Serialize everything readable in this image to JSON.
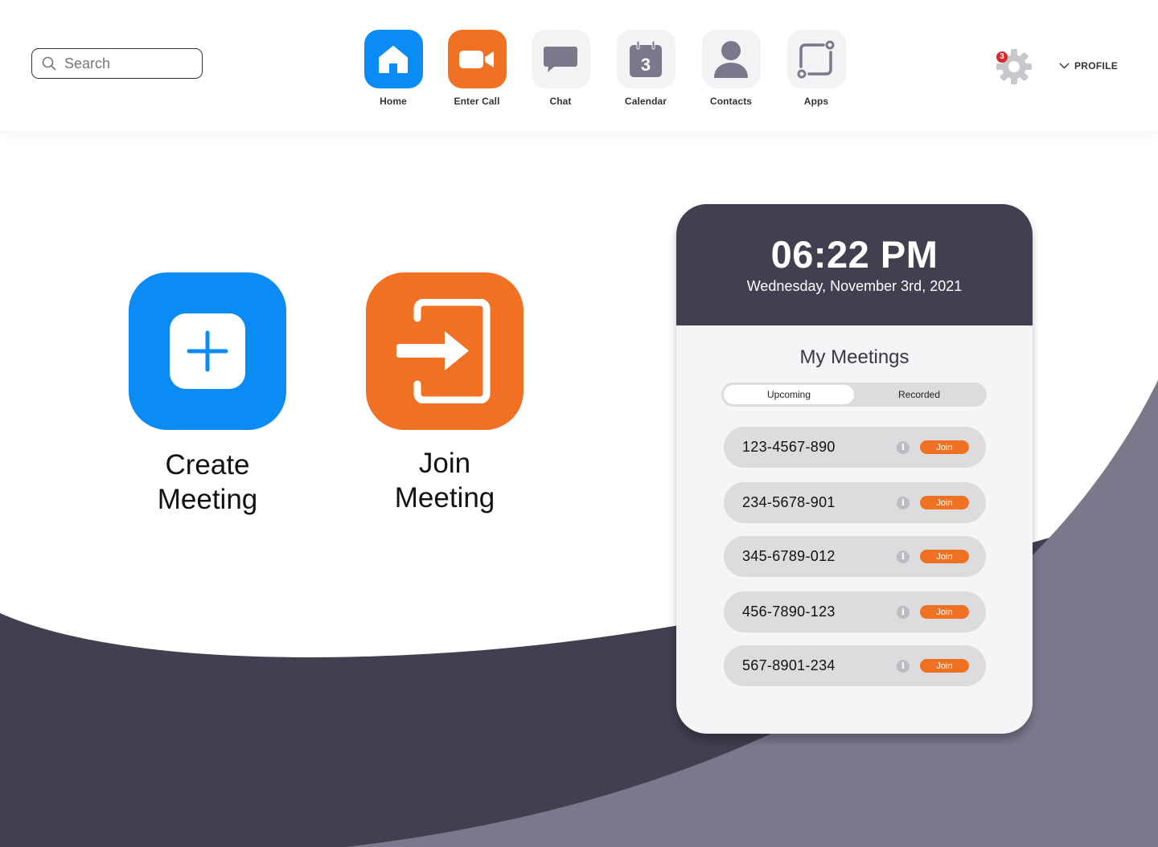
{
  "search": {
    "placeholder": "Search"
  },
  "nav": [
    {
      "label": "Home",
      "icon": "home-icon",
      "color": "#0b8cf5"
    },
    {
      "label": "Enter Call",
      "icon": "video-camera-icon",
      "color": "#f07124"
    },
    {
      "label": "Chat",
      "icon": "chat-bubble-icon",
      "color": "#f3f3f5"
    },
    {
      "label": "Calendar",
      "icon": "calendar-icon",
      "color": "#f3f3f5",
      "day": "3"
    },
    {
      "label": "Contacts",
      "icon": "person-icon",
      "color": "#f3f3f5"
    },
    {
      "label": "Apps",
      "icon": "apps-icon",
      "color": "#f3f3f5"
    }
  ],
  "settings": {
    "icon": "gear-icon",
    "notifications": "3"
  },
  "profile": {
    "label": "PROFILE",
    "icon": "chevron-down-icon"
  },
  "actions": {
    "create": {
      "label": "Create\nMeeting",
      "icon": "plus-icon",
      "color": "#0b8cf5"
    },
    "join": {
      "label": "Join\nMeeting",
      "icon": "sign-in-icon",
      "color": "#f07124"
    }
  },
  "clock": {
    "time": "06:22 PM",
    "date": "Wednesday, November 3rd, 2021"
  },
  "meetings": {
    "title": "My Meetings",
    "tabs": [
      {
        "label": "Upcoming",
        "active": true
      },
      {
        "label": "Recorded",
        "active": false
      }
    ],
    "join_label": "Join",
    "info_label": "i",
    "items": [
      {
        "id": "123-4567-890"
      },
      {
        "id": "234-5678-901"
      },
      {
        "id": "345-6789-012"
      },
      {
        "id": "456-7890-123"
      },
      {
        "id": "567-8901-234"
      }
    ]
  },
  "colors": {
    "dark": "#433e50",
    "mid": "#7b788c",
    "accent_blue": "#0b8cf5",
    "accent_orange": "#f07124"
  }
}
